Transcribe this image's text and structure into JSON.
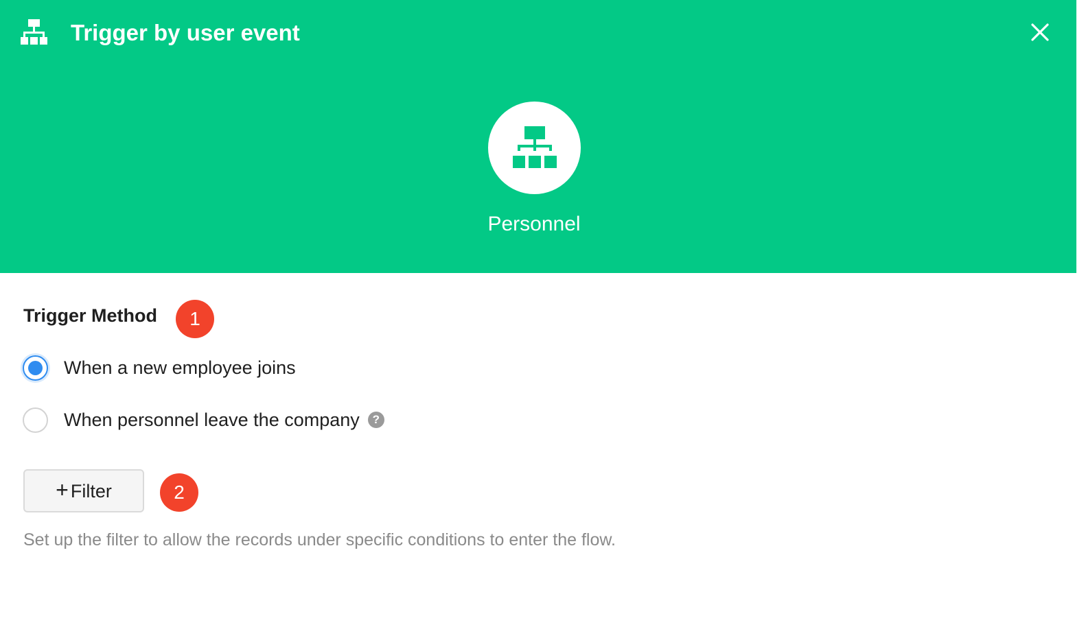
{
  "header": {
    "title": "Trigger by user event",
    "title_icon": "org-chart-icon",
    "close_icon": "close-icon",
    "background_color": "#03c986"
  },
  "hero": {
    "icon": "org-chart-icon",
    "label": "Personnel"
  },
  "trigger_method": {
    "title": "Trigger Method",
    "step_badge": "1",
    "options": [
      {
        "label": "When a new employee joins",
        "selected": true
      },
      {
        "label": "When personnel leave the company",
        "selected": false,
        "help_icon": "question-icon",
        "help_glyph": "?"
      }
    ]
  },
  "filter": {
    "plus_glyph": "+",
    "button_label": "Filter",
    "step_badge": "2",
    "hint": "Set up the filter to allow the records under specific conditions to enter the flow."
  },
  "colors": {
    "accent": "#03c986",
    "radio_selected": "#2f8cf0",
    "badge": "#f2432b"
  }
}
